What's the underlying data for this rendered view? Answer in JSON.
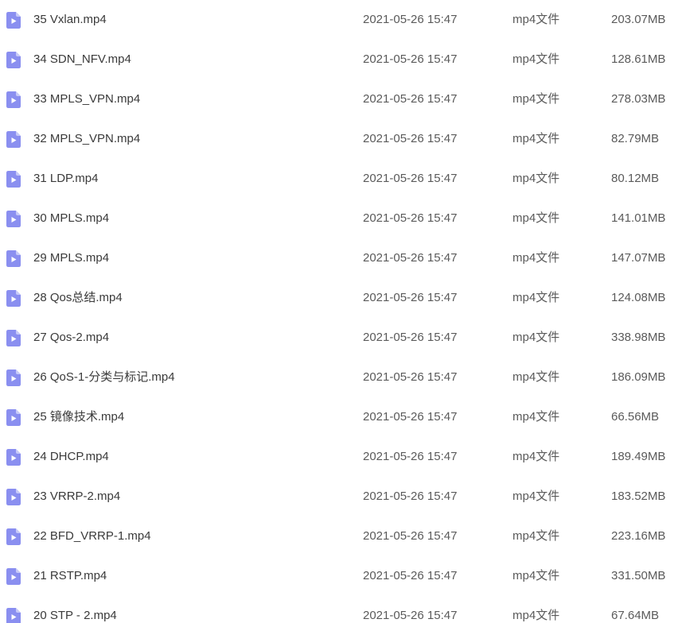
{
  "accent_color": "#8a8ff0",
  "icon": "video-file-icon",
  "files": [
    {
      "name": "35 Vxlan.mp4",
      "modified": "2021-05-26 15:47",
      "type": "mp4文件",
      "size": "203.07MB"
    },
    {
      "name": "34 SDN_NFV.mp4",
      "modified": "2021-05-26 15:47",
      "type": "mp4文件",
      "size": "128.61MB"
    },
    {
      "name": "33 MPLS_VPN.mp4",
      "modified": "2021-05-26 15:47",
      "type": "mp4文件",
      "size": "278.03MB"
    },
    {
      "name": "32 MPLS_VPN.mp4",
      "modified": "2021-05-26 15:47",
      "type": "mp4文件",
      "size": "82.79MB"
    },
    {
      "name": "31 LDP.mp4",
      "modified": "2021-05-26 15:47",
      "type": "mp4文件",
      "size": "80.12MB"
    },
    {
      "name": "30 MPLS.mp4",
      "modified": "2021-05-26 15:47",
      "type": "mp4文件",
      "size": "141.01MB"
    },
    {
      "name": "29 MPLS.mp4",
      "modified": "2021-05-26 15:47",
      "type": "mp4文件",
      "size": "147.07MB"
    },
    {
      "name": "28 Qos总结.mp4",
      "modified": "2021-05-26 15:47",
      "type": "mp4文件",
      "size": "124.08MB"
    },
    {
      "name": "27 Qos-2.mp4",
      "modified": "2021-05-26 15:47",
      "type": "mp4文件",
      "size": "338.98MB"
    },
    {
      "name": "26 QoS-1-分类与标记.mp4",
      "modified": "2021-05-26 15:47",
      "type": "mp4文件",
      "size": "186.09MB"
    },
    {
      "name": "25 镜像技术.mp4",
      "modified": "2021-05-26 15:47",
      "type": "mp4文件",
      "size": "66.56MB"
    },
    {
      "name": "24 DHCP.mp4",
      "modified": "2021-05-26 15:47",
      "type": "mp4文件",
      "size": "189.49MB"
    },
    {
      "name": "23 VRRP-2.mp4",
      "modified": "2021-05-26 15:47",
      "type": "mp4文件",
      "size": "183.52MB"
    },
    {
      "name": "22 BFD_VRRP-1.mp4",
      "modified": "2021-05-26 15:47",
      "type": "mp4文件",
      "size": "223.16MB"
    },
    {
      "name": "21 RSTP.mp4",
      "modified": "2021-05-26 15:47",
      "type": "mp4文件",
      "size": "331.50MB"
    },
    {
      "name": "20 STP - 2.mp4",
      "modified": "2021-05-26 15:47",
      "type": "mp4文件",
      "size": "67.64MB"
    }
  ]
}
